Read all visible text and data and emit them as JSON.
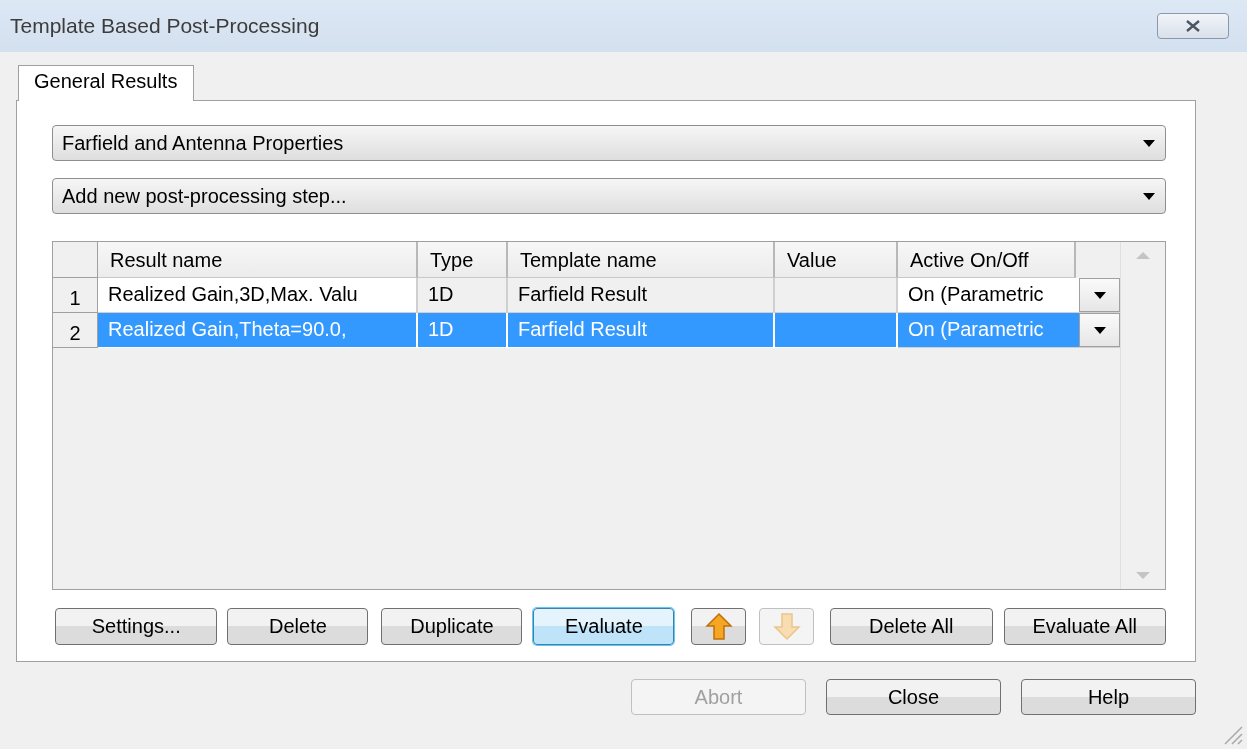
{
  "window": {
    "title": "Template Based Post-Processing"
  },
  "tabs": [
    {
      "label": "General Results",
      "selected": true
    }
  ],
  "category_dropdown": {
    "value": "Farfield and Antenna Properties"
  },
  "step_dropdown": {
    "value": "Add new post-processing step..."
  },
  "table": {
    "columns": [
      {
        "label": "Result name",
        "editable": true
      },
      {
        "label": "Type",
        "editable": false
      },
      {
        "label": "Template name",
        "editable": false
      },
      {
        "label": "Value",
        "editable": false
      },
      {
        "label": "Active On/Off",
        "editable": true
      }
    ],
    "rows": [
      {
        "number": "1",
        "selected": false,
        "cells": [
          "Realized Gain,3D,Max. Valu",
          "1D",
          "Farfield Result",
          "",
          "On (Parametric"
        ]
      },
      {
        "number": "2",
        "selected": true,
        "cells": [
          "Realized Gain,Theta=90.0,",
          "1D",
          "Farfield Result",
          "",
          "On (Parametric"
        ]
      }
    ]
  },
  "step_buttons": [
    {
      "kind": "text",
      "label": "Settings...",
      "disabled": false,
      "focused": false
    },
    {
      "kind": "text",
      "label": "Delete",
      "disabled": false,
      "focused": false
    },
    {
      "kind": "text",
      "label": "Duplicate",
      "disabled": false,
      "focused": false
    },
    {
      "kind": "text",
      "label": "Evaluate",
      "disabled": false,
      "focused": true
    },
    {
      "kind": "up",
      "disabled": false,
      "focused": false
    },
    {
      "kind": "down",
      "disabled": true,
      "focused": false
    },
    {
      "kind": "text",
      "label": "Delete All",
      "disabled": false,
      "focused": false
    },
    {
      "kind": "text",
      "label": "Evaluate All",
      "disabled": false,
      "focused": false
    }
  ],
  "dialog_buttons": [
    {
      "label": "Abort",
      "disabled": true
    },
    {
      "label": "Close",
      "disabled": false
    },
    {
      "label": "Help",
      "disabled": false
    }
  ]
}
